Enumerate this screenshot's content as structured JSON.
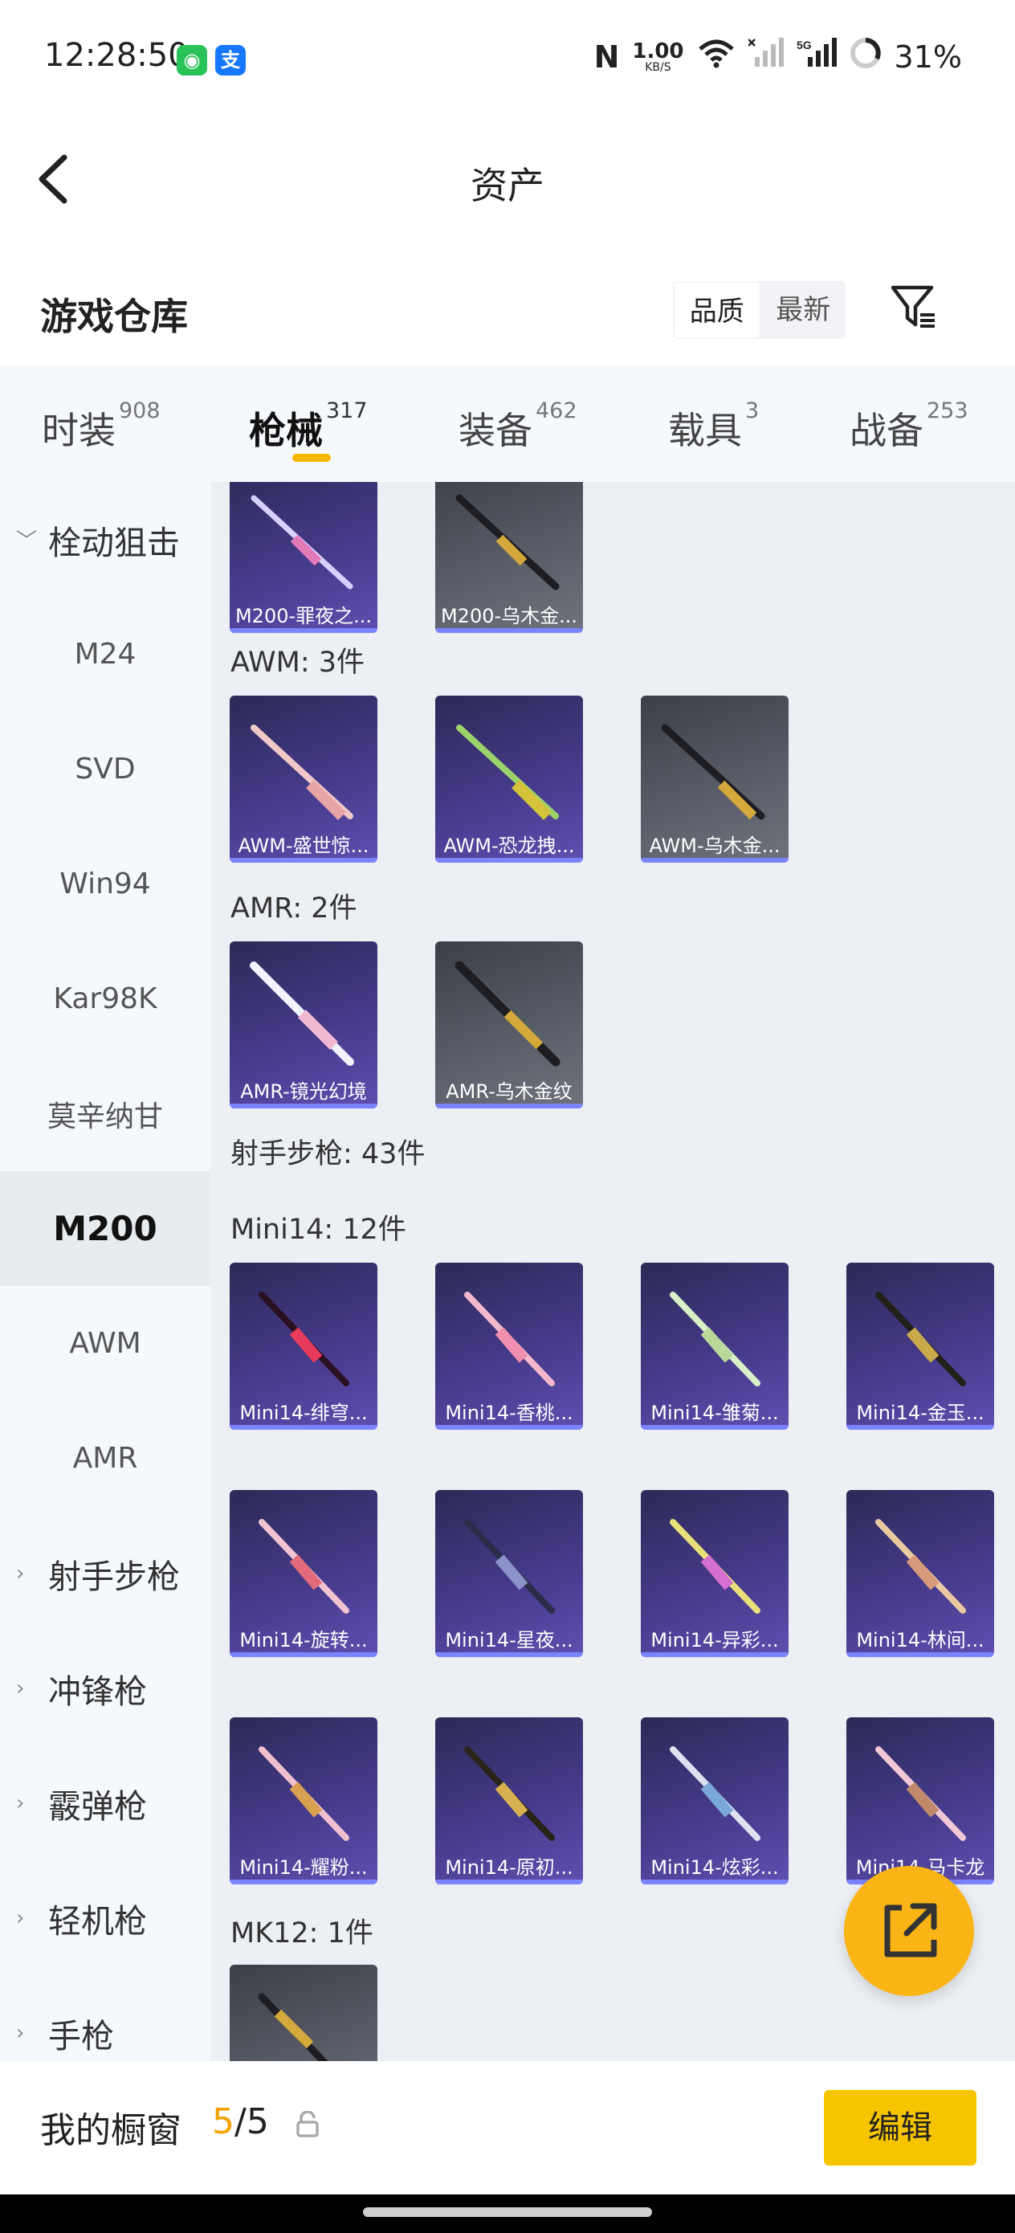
{
  "status": {
    "time": "12:28:50",
    "net_speed_value": "1.00",
    "net_speed_unit": "KB/S",
    "battery": "31%"
  },
  "header": {
    "title": "资产"
  },
  "warehouse": {
    "title": "游戏仓库",
    "sort": [
      "品质",
      "最新"
    ]
  },
  "tabs": [
    {
      "label": "时装",
      "count": "908"
    },
    {
      "label": "枪械",
      "count": "317"
    },
    {
      "label": "装备",
      "count": "462"
    },
    {
      "label": "载具",
      "count": "3"
    },
    {
      "label": "战备",
      "count": "253"
    }
  ],
  "sidebar": [
    {
      "label": "栓动狙击"
    },
    {
      "label": "M24"
    },
    {
      "label": "SVD"
    },
    {
      "label": "Win94"
    },
    {
      "label": "Kar98K"
    },
    {
      "label": "莫辛纳甘"
    },
    {
      "label": "M200"
    },
    {
      "label": "AWM"
    },
    {
      "label": "AMR"
    },
    {
      "label": "射手步枪"
    },
    {
      "label": "冲锋枪"
    },
    {
      "label": "霰弹枪"
    },
    {
      "label": "轻机枪"
    },
    {
      "label": "手枪"
    }
  ],
  "sections": [
    {
      "label": "AWM: 3件"
    },
    {
      "label": "AMR: 2件"
    },
    {
      "label": "射手步枪: 43件"
    },
    {
      "label": "Mini14: 12件"
    },
    {
      "label": "MK12: 1件"
    }
  ],
  "cards": [
    {
      "label": "M200-罪夜之...",
      "style": "purple"
    },
    {
      "label": "M200-乌木金...",
      "style": "gray"
    },
    {
      "label": "AWM-盛世惊...",
      "style": "purple"
    },
    {
      "label": "AWM-恐龙拽...",
      "style": "purple"
    },
    {
      "label": "AWM-乌木金...",
      "style": "gray"
    },
    {
      "label": "AMR-镜光幻境",
      "style": "purple"
    },
    {
      "label": "AMR-乌木金纹",
      "style": "gray"
    },
    {
      "label": "Mini14-绯穹...",
      "style": "purple"
    },
    {
      "label": "Mini14-香桃...",
      "style": "purple"
    },
    {
      "label": "Mini14-雏菊...",
      "style": "purple"
    },
    {
      "label": "Mini14-金玉...",
      "style": "purple"
    },
    {
      "label": "Mini14-旋转...",
      "style": "purple"
    },
    {
      "label": "Mini14-星夜...",
      "style": "purple"
    },
    {
      "label": "Mini14-异彩...",
      "style": "purple"
    },
    {
      "label": "Mini14-林间...",
      "style": "purple"
    },
    {
      "label": "Mini14-耀粉...",
      "style": "purple"
    },
    {
      "label": "Mini14-原初...",
      "style": "purple"
    },
    {
      "label": "Mini14-炫彩...",
      "style": "purple"
    },
    {
      "label": "Mini14-马卡龙",
      "style": "purple"
    },
    {
      "label": "",
      "style": "gray"
    }
  ],
  "bottom": {
    "showcase_label": "我的橱窗",
    "count_current": "5",
    "count_sep": "/",
    "count_total": "5",
    "edit_label": "编辑"
  },
  "colors": {
    "accent": "#f7c400",
    "fab": "#fbb416",
    "card_purple": "#463a8a",
    "card_gray": "#5b5f69"
  }
}
